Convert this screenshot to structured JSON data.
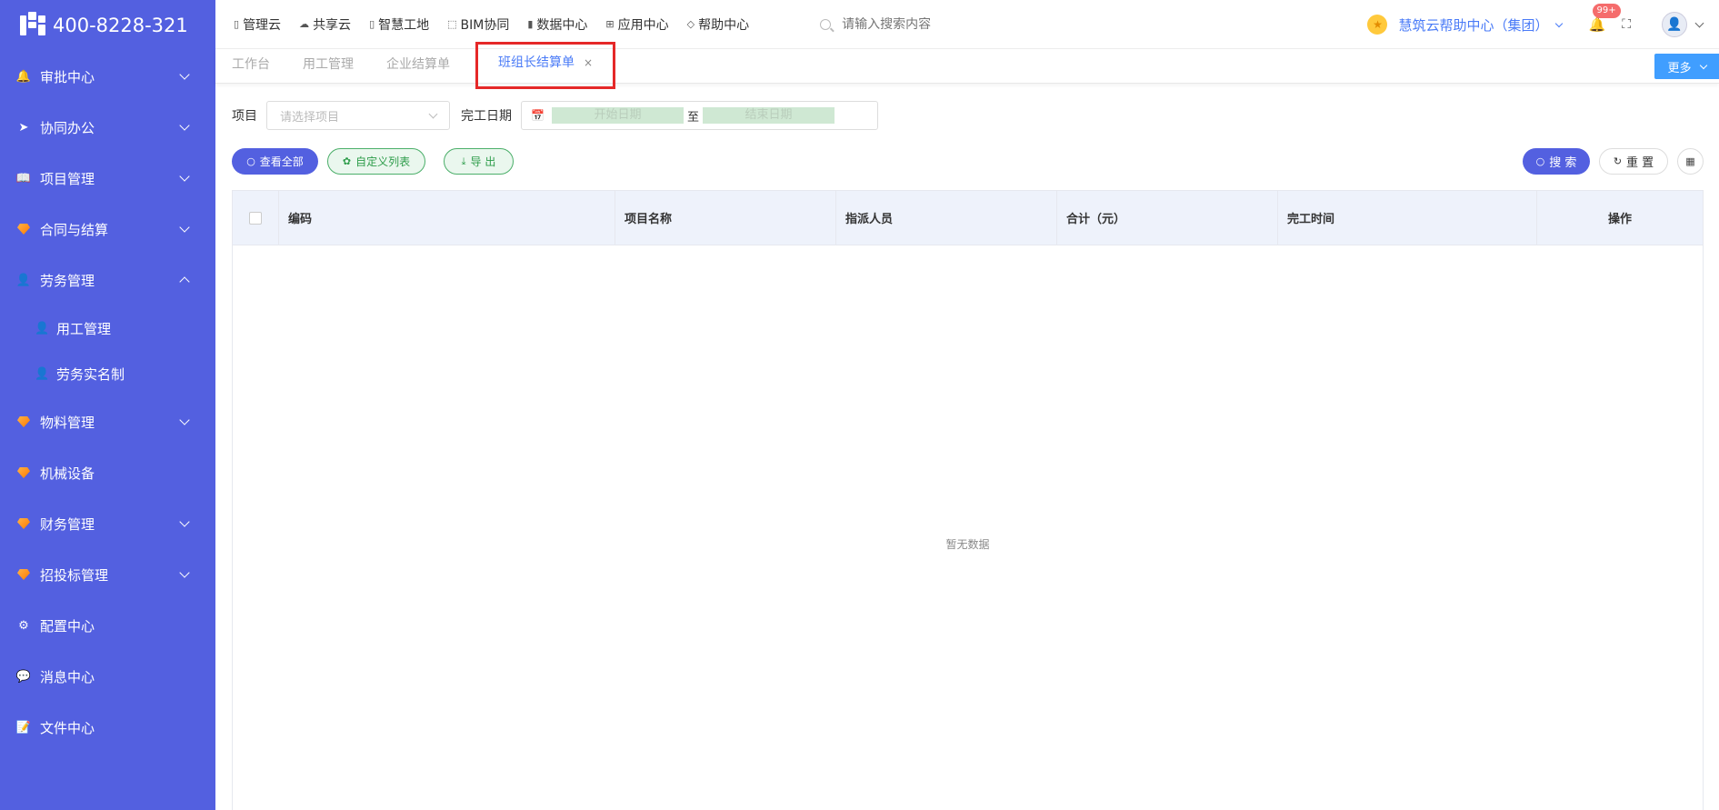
{
  "logo": {
    "phone": "400-8228-321"
  },
  "sidebar": {
    "items": [
      {
        "label": "审批中心",
        "icon": "bell-icon",
        "glyph": "🔔",
        "expandable": true,
        "expanded": false
      },
      {
        "label": "协同办公",
        "icon": "send-icon",
        "glyph": "➤",
        "expandable": true,
        "expanded": false
      },
      {
        "label": "项目管理",
        "icon": "book-icon",
        "glyph": "📖",
        "expandable": true,
        "expanded": false
      },
      {
        "label": "合同与结算",
        "icon": "gem-icon",
        "glyph": "gem",
        "expandable": true,
        "expanded": false
      },
      {
        "label": "劳务管理",
        "icon": "user-icon",
        "glyph": "👤",
        "expandable": true,
        "expanded": true,
        "children": [
          {
            "label": "用工管理",
            "icon": "user-icon"
          },
          {
            "label": "劳务实名制",
            "icon": "user-icon"
          }
        ]
      },
      {
        "label": "物料管理",
        "icon": "gem-icon",
        "glyph": "gem",
        "expandable": true,
        "expanded": false
      },
      {
        "label": "机械设备",
        "icon": "gem-icon",
        "glyph": "gem",
        "expandable": false
      },
      {
        "label": "财务管理",
        "icon": "gem-icon",
        "glyph": "gem",
        "expandable": true,
        "expanded": false
      },
      {
        "label": "招投标管理",
        "icon": "gem-icon",
        "glyph": "gem",
        "expandable": true,
        "expanded": false
      },
      {
        "label": "配置中心",
        "icon": "gear-icon",
        "glyph": "⚙",
        "expandable": false
      },
      {
        "label": "消息中心",
        "icon": "message-icon",
        "glyph": "💬",
        "expandable": false
      },
      {
        "label": "文件中心",
        "icon": "file-icon",
        "glyph": "📝",
        "expandable": false
      }
    ]
  },
  "topnav": {
    "items": [
      {
        "label": "管理云",
        "icon": "cloud-doc-icon"
      },
      {
        "label": "共享云",
        "icon": "cloud-icon"
      },
      {
        "label": "智慧工地",
        "icon": "book-icon"
      },
      {
        "label": "BIM协同",
        "icon": "cube-icon"
      },
      {
        "label": "数据中心",
        "icon": "bar-chart-icon"
      },
      {
        "label": "应用中心",
        "icon": "apps-icon"
      },
      {
        "label": "帮助中心",
        "icon": "diamond-icon"
      }
    ],
    "search_placeholder": "请输入搜索内容"
  },
  "header": {
    "org_name": "慧筑云帮助中心（集团）",
    "notification_badge": "99+"
  },
  "tabs": [
    {
      "label": "工作台",
      "active": false
    },
    {
      "label": "用工管理",
      "active": false
    },
    {
      "label": "企业结算单",
      "active": false
    },
    {
      "label": "班组长结算单",
      "active": true,
      "close": "×"
    }
  ],
  "more_label": "更多",
  "filters": {
    "project_label": "项目",
    "project_placeholder": "请选择项目",
    "date_label": "完工日期",
    "start_placeholder": "开始日期",
    "separator": "至",
    "end_placeholder": "结束日期"
  },
  "actions": {
    "view_all": "查看全部",
    "custom_list": "自定义列表",
    "export": "导 出",
    "search": "搜 索",
    "reset": "重 置"
  },
  "table": {
    "columns": [
      "编码",
      "项目名称",
      "指派人员",
      "合计（元）",
      "完工时间",
      "操作"
    ],
    "empty_text": "暂无数据"
  },
  "colors": {
    "sidebar_bg": "#5360e0",
    "accent": "#4a7bf7",
    "highlight_border": "#e52828"
  }
}
